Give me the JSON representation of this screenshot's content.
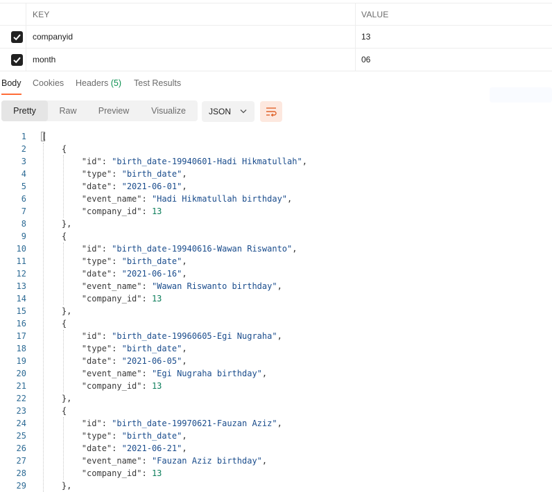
{
  "params": {
    "headers": {
      "key": "KEY",
      "value": "VALUE"
    },
    "rows": [
      {
        "key": "companyid",
        "value": "13",
        "checked": true
      },
      {
        "key": "month",
        "value": "06",
        "checked": true
      }
    ]
  },
  "response_tabs": {
    "body": "Body",
    "cookies": "Cookies",
    "headers": "Headers",
    "headers_count": "(5)",
    "test_results": "Test Results"
  },
  "format_toolbar": {
    "pretty": "Pretty",
    "raw": "Raw",
    "preview": "Preview",
    "visualize": "Visualize",
    "format": "JSON"
  },
  "code": {
    "line_numbers": [
      "1",
      "2",
      "3",
      "4",
      "5",
      "6",
      "7",
      "8",
      "9",
      "10",
      "11",
      "12",
      "13",
      "14",
      "15",
      "16",
      "17",
      "18",
      "19",
      "20",
      "21",
      "22",
      "23",
      "24",
      "25",
      "26",
      "27",
      "28",
      "29"
    ],
    "open_bracket": "[",
    "records": [
      {
        "id": "birth_date-19940601-Hadi Hikmatullah",
        "type": "birth_date",
        "date": "2021-06-01",
        "event_name": "Hadi Hikmatullah birthday",
        "company_id": "13"
      },
      {
        "id": "birth_date-19940616-Wawan Riswanto",
        "type": "birth_date",
        "date": "2021-06-16",
        "event_name": "Wawan Riswanto birthday",
        "company_id": "13"
      },
      {
        "id": "birth_date-19960605-Egi Nugraha",
        "type": "birth_date",
        "date": "2021-06-05",
        "event_name": "Egi Nugraha birthday",
        "company_id": "13"
      },
      {
        "id": "birth_date-19970621-Fauzan Aziz",
        "type": "birth_date",
        "date": "2021-06-21",
        "event_name": "Fauzan Aziz birthday",
        "company_id": "13"
      }
    ]
  }
}
